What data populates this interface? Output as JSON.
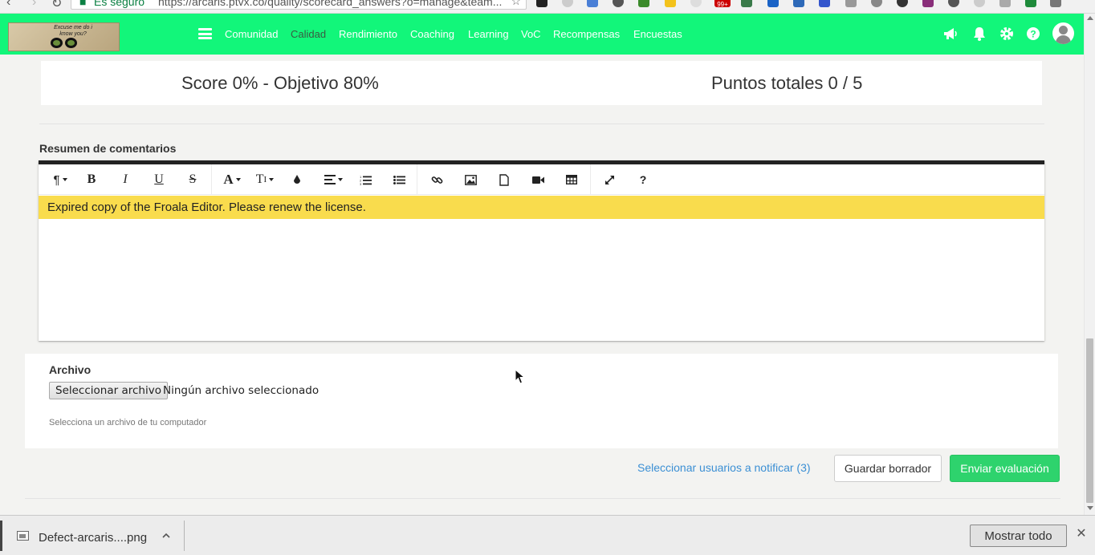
{
  "browser": {
    "secure_label": "Es seguro",
    "url": "https://arcaris.ptvx.co/quality/scorecard_answers?o=manage&team...",
    "download_badge": "99+"
  },
  "header": {
    "logo_text": "Excuse me do i know you?",
    "nav": [
      {
        "label": "Comunidad",
        "active": false
      },
      {
        "label": "Calidad",
        "active": true
      },
      {
        "label": "Rendimiento",
        "active": false
      },
      {
        "label": "Coaching",
        "active": false
      },
      {
        "label": "Learning",
        "active": false
      },
      {
        "label": "VoC",
        "active": false
      },
      {
        "label": "Recompensas",
        "active": false
      },
      {
        "label": "Encuestas",
        "active": false
      }
    ],
    "icons": [
      "megaphone-icon",
      "bell-icon",
      "gear-icon",
      "help-icon"
    ]
  },
  "score": {
    "summary": "Score 0% - Objetivo 80%",
    "points": "Puntos totales 0 / 5"
  },
  "comments": {
    "label": "Resumen de comentarios",
    "license_notice": "Expired copy of the Froala Editor. Please renew the license.",
    "toolbar": [
      "paragraph-format",
      "bold",
      "italic",
      "underline",
      "strikethrough",
      "font-family",
      "font-size",
      "color",
      "align",
      "ordered-list",
      "unordered-list",
      "link",
      "image",
      "file",
      "video",
      "table",
      "fullscreen",
      "help"
    ]
  },
  "file": {
    "label": "Archivo",
    "button": "Seleccionar archivo",
    "status": "Ningún archivo seleccionado",
    "help": "Selecciona un archivo de tu computador"
  },
  "actions": {
    "notify": "Seleccionar usuarios a notificar (3)",
    "save_draft": "Guardar borrador",
    "submit": "Enviar evaluación"
  },
  "download_shelf": {
    "file_name": "Defect-arcaris....png",
    "show_all": "Mostrar todo"
  },
  "colors": {
    "header_bg": "#12f67a",
    "submit_bg": "#2ed36d",
    "link": "#3b8fd4",
    "license_banner": "#f9dc4d"
  }
}
